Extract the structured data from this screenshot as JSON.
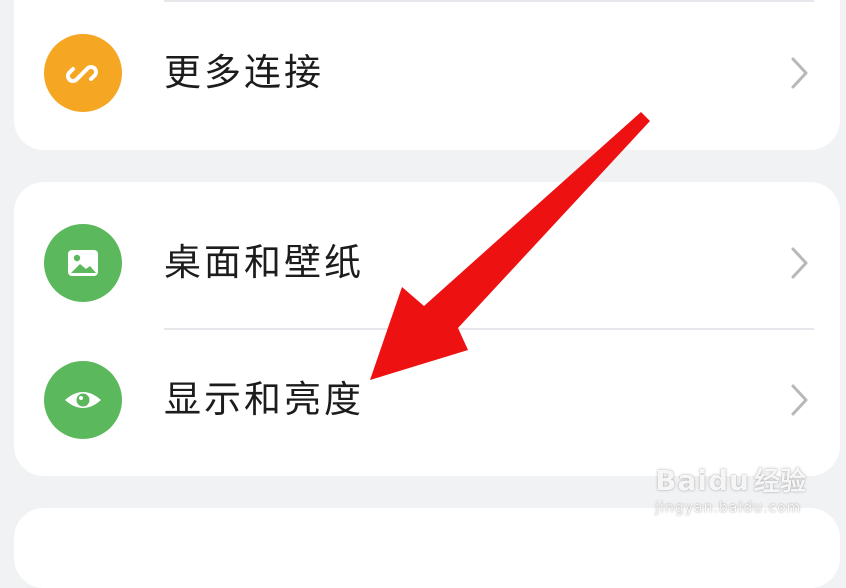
{
  "settings": {
    "items": [
      {
        "label": "更多连接",
        "icon": "link-icon",
        "color": "#f5a623"
      },
      {
        "label": "桌面和壁纸",
        "icon": "image-icon",
        "color": "#5cb85c"
      },
      {
        "label": "显示和亮度",
        "icon": "eye-icon",
        "color": "#5cb85c"
      }
    ]
  },
  "annotation": {
    "color": "#ee1111",
    "type": "arrow"
  },
  "watermark": {
    "logo": "Baidu",
    "text": "经验",
    "domain": "jingyan.baidu.com"
  }
}
